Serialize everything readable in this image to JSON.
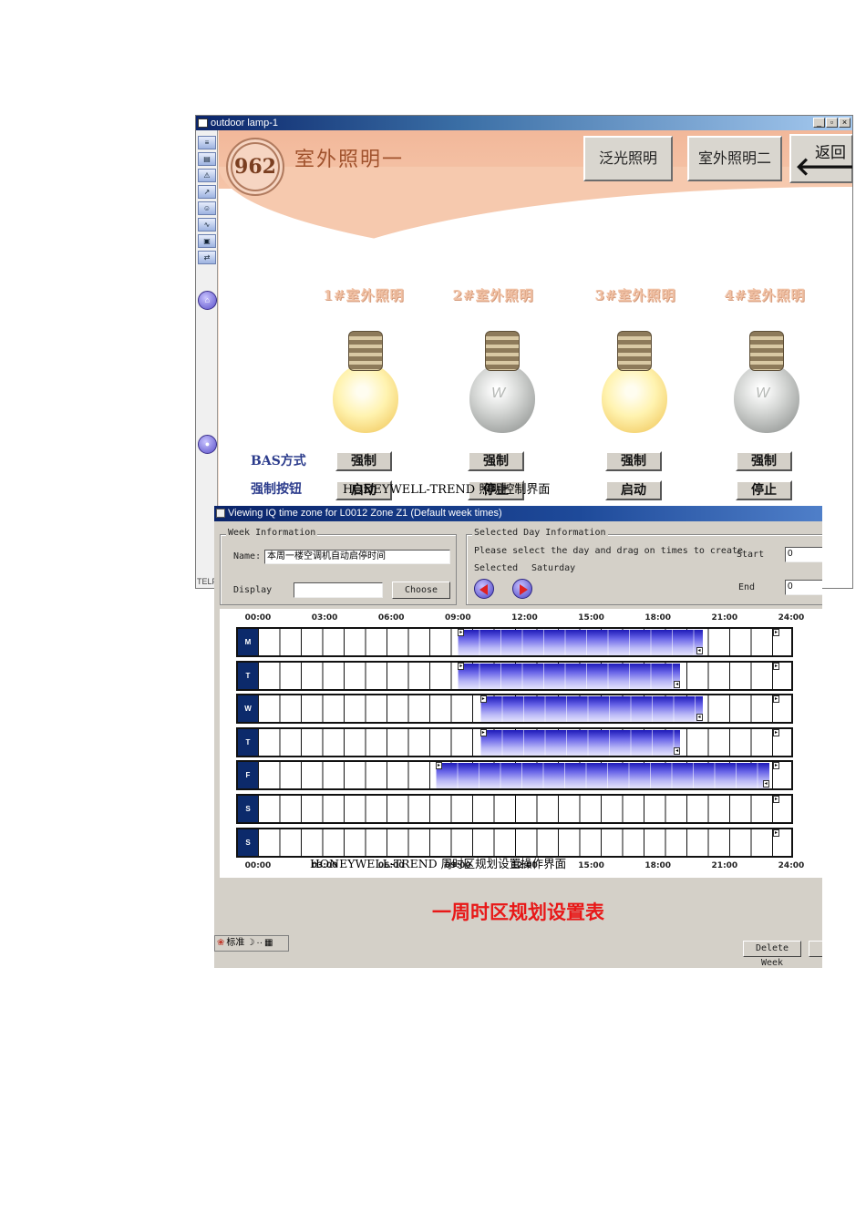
{
  "window1": {
    "title": "outdoor lamp-1",
    "win_buttons": [
      "_",
      "▫",
      "×"
    ],
    "toolbar_icons": [
      "menu-icon",
      "report-icon",
      "alarm-icon",
      "trend-icon",
      "user-icon",
      "wave-icon",
      "system-icon",
      "link-icon"
    ],
    "telf_label": "TELF",
    "logo_text": "962",
    "screen_title": "室外照明一",
    "nav": {
      "floodlight": "泛光照明",
      "outdoor2": "室外照明二",
      "back": "返回"
    },
    "lamps": [
      {
        "name": "1#室外照明",
        "state": "on"
      },
      {
        "name": "2#室外照明",
        "state": "off"
      },
      {
        "name": "3#室外照明",
        "state": "on"
      },
      {
        "name": "4#室外照明",
        "state": "off"
      }
    ],
    "row_labels": {
      "bas": "BAS方式",
      "force": "强制按钮"
    },
    "mode_buttons": [
      "强制",
      "强制",
      "强制",
      "强制"
    ],
    "force_buttons": [
      "启动",
      "停止",
      "启动",
      "停止"
    ]
  },
  "caption1": "HONEYWELL-TREND 照明控制界面",
  "window2": {
    "title": "Viewing IQ time zone for L0012 Zone Z1 (Default week times)",
    "week_info": {
      "legend": "Week Information",
      "name_label": "Name:",
      "name_value": "本周一楼空调机自动启停时间",
      "display_label": "Display",
      "display_value": "",
      "choose_button": "Choose"
    },
    "day_info": {
      "legend": "Selected Day Information",
      "instruction": "Please select the day and drag on times to create",
      "selected_label": "Selected",
      "selected_value": "Saturday",
      "start_label": "Start",
      "start_value": "0",
      "end_label": "End",
      "end_value": "0"
    },
    "time_ticks": [
      "00:00",
      "03:00",
      "06:00",
      "09:00",
      "12:00",
      "15:00",
      "18:00",
      "21:00",
      "24:00"
    ],
    "days": [
      {
        "label": "M",
        "start": "09:00",
        "end": "20:00"
      },
      {
        "label": "T",
        "start": "09:00",
        "end": "19:00"
      },
      {
        "label": "W",
        "start": "10:00",
        "end": "20:00"
      },
      {
        "label": "T",
        "start": "10:00",
        "end": "19:00"
      },
      {
        "label": "F",
        "start": "08:00",
        "end": "23:00"
      },
      {
        "label": "S",
        "start": "",
        "end": ""
      },
      {
        "label": "S",
        "start": "",
        "end": ""
      }
    ],
    "caption2": "HONEYWELL-TREND 周时区规划设置操作界面",
    "big_caption": "一周时区规划设置表",
    "status_text": "标准",
    "delete_week_button": "Delete Week"
  }
}
